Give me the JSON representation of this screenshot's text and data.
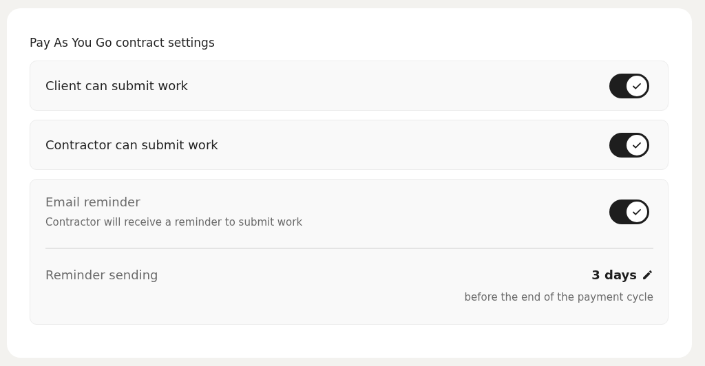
{
  "title": "Pay As You Go contract settings",
  "settings": [
    {
      "label": "Client can submit work",
      "on": true
    },
    {
      "label": "Contractor can submit work",
      "on": true
    }
  ],
  "reminder": {
    "label": "Email reminder",
    "description": "Contractor will receive a reminder to submit work",
    "on": true,
    "sending": {
      "label": "Reminder sending",
      "value": "3 days",
      "note": "before the end of the payment cycle"
    }
  }
}
